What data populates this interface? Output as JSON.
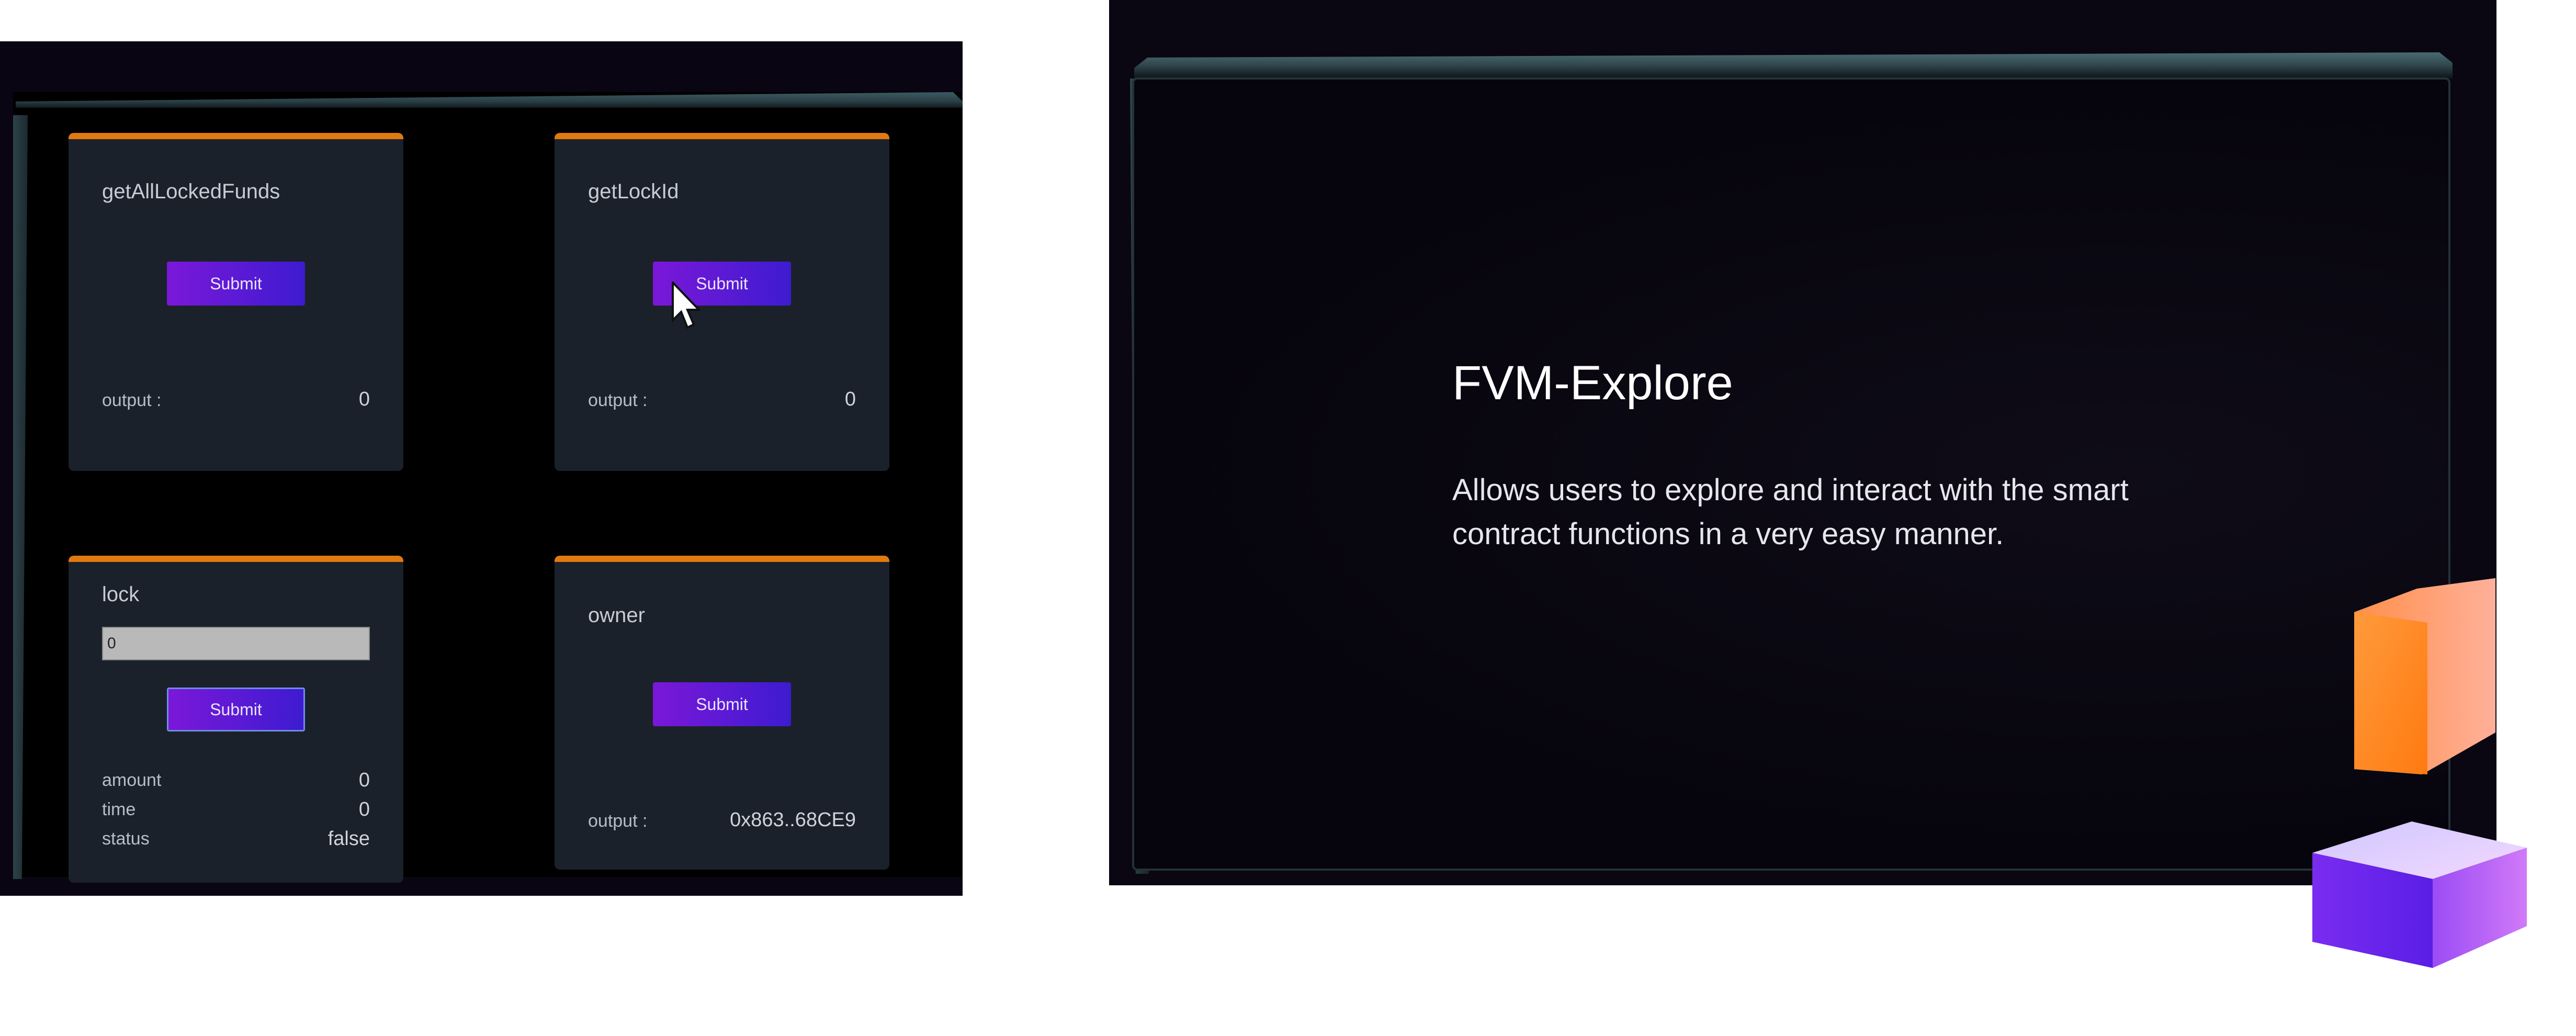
{
  "cards": [
    {
      "title": "getAllLockedFunds",
      "submit_label": "Submit",
      "output_label": "output :",
      "output_value": "0"
    },
    {
      "title": "getLockId",
      "submit_label": "Submit",
      "output_label": "output :",
      "output_value": "0"
    },
    {
      "title": "lock",
      "input_value": "0",
      "submit_label": "Submit",
      "rows": [
        {
          "label": "amount",
          "value": "0"
        },
        {
          "label": "time",
          "value": "0"
        },
        {
          "label": "status",
          "value": "false"
        }
      ]
    },
    {
      "title": "owner",
      "submit_label": "Submit",
      "output_label": "output :",
      "output_value": "0x863..68CE9"
    }
  ],
  "hero": {
    "title": "FVM-Explore",
    "description": "Allows users to explore and interact with the smart contract functions in a very easy manner."
  },
  "colors": {
    "accent_orange": "#e07a10",
    "button_gradient_start": "#7b18d8",
    "button_gradient_end": "#3d1bd0",
    "card_bg": "#1b212a",
    "screen_bg": "#06040c"
  },
  "icons": [
    "mouse-cursor-icon",
    "orange-cube-icon",
    "purple-cube-icon"
  ]
}
